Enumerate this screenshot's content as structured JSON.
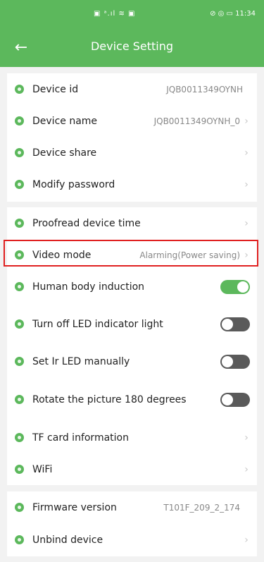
{
  "status_bar": {
    "center": "▣ ᵃ.ıl ≋ ▣",
    "right": "⊘ ◎ ▭ 11:34"
  },
  "header": {
    "back_glyph": "←",
    "title": "Device Setting"
  },
  "rows": [
    {
      "label": "Device id",
      "value": "JQB0011349OYNH",
      "chevron": ""
    },
    {
      "label": "Device name",
      "value": "JQB0011349OYNH_0",
      "chevron": "›"
    },
    {
      "label": "Device share",
      "value": "",
      "chevron": "›"
    },
    {
      "label": "Modify password",
      "value": "",
      "chevron": "›"
    },
    {
      "label": "Proofread device time",
      "value": "",
      "chevron": "›"
    },
    {
      "label": "Video mode",
      "value": "Alarming(Power saving)",
      "chevron": "›"
    },
    {
      "label": "Human body induction",
      "toggle": "on"
    },
    {
      "label": "Turn off LED indicator light",
      "toggle": "off"
    },
    {
      "label": "Set Ir LED manually",
      "toggle": "off"
    },
    {
      "label": "Rotate the picture 180 degrees",
      "toggle": "off"
    },
    {
      "label": "TF card information",
      "value": "",
      "chevron": "›"
    },
    {
      "label": "WiFi",
      "value": "",
      "chevron": "›"
    },
    {
      "label": "Firmware version",
      "value": "T101F_209_2_174",
      "chevron": ""
    },
    {
      "label": "Unbind device",
      "value": "",
      "chevron": "›"
    }
  ],
  "colors": {
    "accent": "#5cb85c",
    "highlight": "#e02020",
    "toggle_off": "#5a5a5a"
  }
}
